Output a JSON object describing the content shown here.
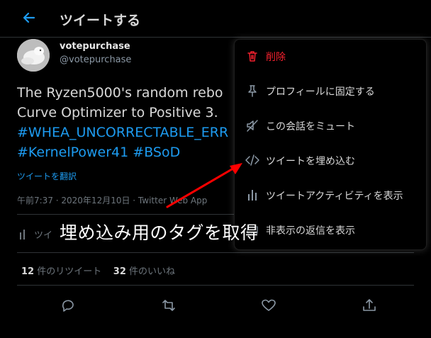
{
  "header": {
    "title": "ツイートする",
    "back_icon": "arrow-left-icon"
  },
  "tweet": {
    "display_name": "votepurchase",
    "handle": "@votepurchase",
    "text_line1": "The Ryzen5000's random rebo",
    "text_line2": "Curve Optimizer to Positive 3.",
    "hashtag1": "#WHEA_UNCORRECTABLE_ERR",
    "hashtag2": "#KernelPower41",
    "hashtag3": "#BSoD",
    "translate_link": "ツイートを翻訳",
    "meta": "午前7:37 · 2020年12月10日 · Twitter Web App",
    "activity_label": "ツイ",
    "retweet_count": "12",
    "retweet_label": "件のリツイート",
    "like_count": "32",
    "like_label": "件のいいね"
  },
  "menu": {
    "items": [
      {
        "label": "削除",
        "icon": "trash-icon"
      },
      {
        "label": "プロフィールに固定する",
        "icon": "pin-icon"
      },
      {
        "label": "この会話をミュート",
        "icon": "mute-icon"
      },
      {
        "label": "ツイートを埋め込む",
        "icon": "code-icon"
      },
      {
        "label": "ツイートアクティビティを表示",
        "icon": "bar-chart-icon"
      },
      {
        "label": "非表示の返信を表示",
        "icon": "hidden-replies-icon"
      }
    ]
  },
  "annotation": {
    "text": "埋め込み用のタグを取得"
  },
  "colors": {
    "accent": "#1d9bf0",
    "danger": "#f4212e",
    "background": "#000000",
    "annotation_arrow": "#ff0000"
  }
}
